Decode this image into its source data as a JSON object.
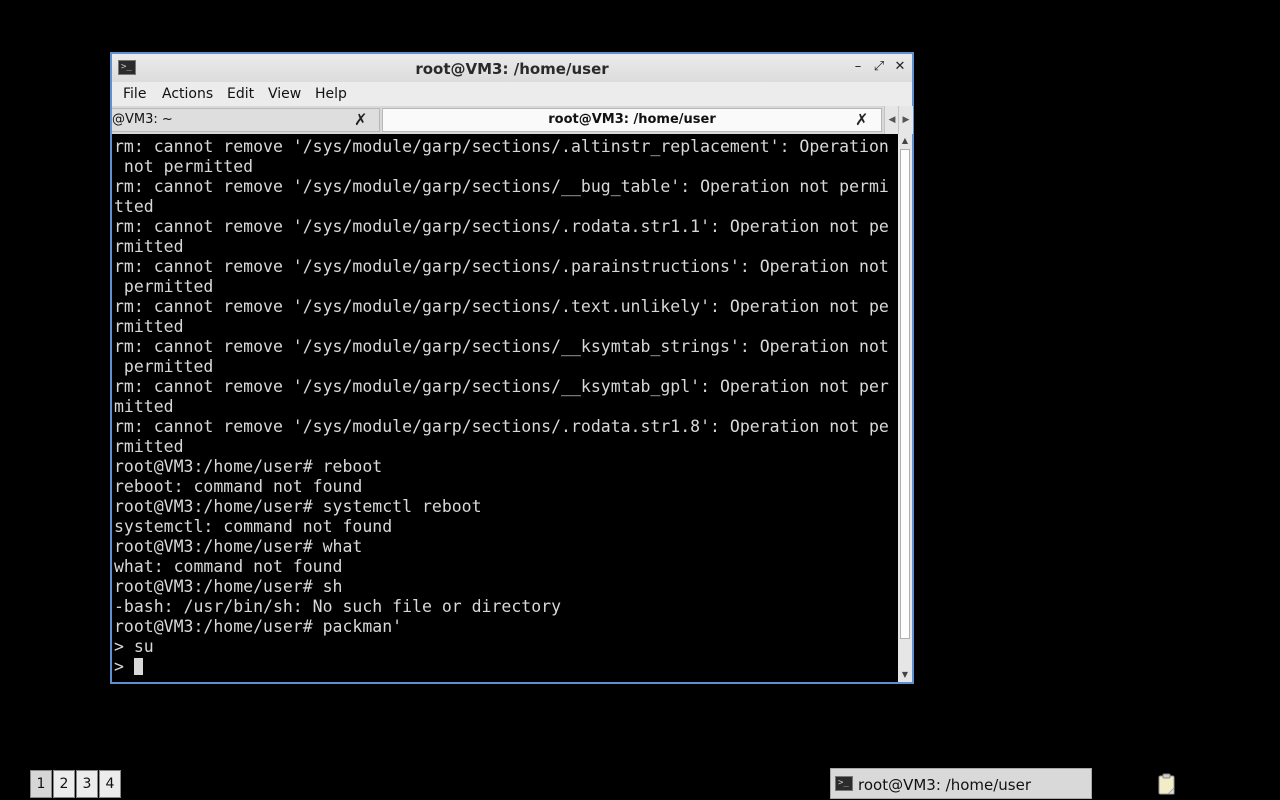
{
  "window": {
    "title": "root@VM3: /home/user",
    "app_icon": "terminal-icon",
    "controls": {
      "minimize": "–",
      "maximize": "⤢",
      "close": "✕"
    }
  },
  "menubar": {
    "items": [
      {
        "label": "File"
      },
      {
        "label": "Actions"
      },
      {
        "label": "Edit"
      },
      {
        "label": "View"
      },
      {
        "label": "Help"
      }
    ]
  },
  "tabs": [
    {
      "label": "@VM3: ~",
      "active": false,
      "close": "✗"
    },
    {
      "label": "root@VM3: /home/user",
      "active": true,
      "close": "✗"
    }
  ],
  "tab_scroll": {
    "left": "◀",
    "right": "▶"
  },
  "terminal": {
    "lines": [
      "rm: cannot remove '/sys/module/garp/sections/.altinstr_replacement': Operation",
      " not permitted",
      "rm: cannot remove '/sys/module/garp/sections/__bug_table': Operation not permi",
      "tted",
      "rm: cannot remove '/sys/module/garp/sections/.rodata.str1.1': Operation not pe",
      "rmitted",
      "rm: cannot remove '/sys/module/garp/sections/.parainstructions': Operation not",
      " permitted",
      "rm: cannot remove '/sys/module/garp/sections/.text.unlikely': Operation not pe",
      "rmitted",
      "rm: cannot remove '/sys/module/garp/sections/__ksymtab_strings': Operation not",
      " permitted",
      "rm: cannot remove '/sys/module/garp/sections/__ksymtab_gpl': Operation not per",
      "mitted",
      "rm: cannot remove '/sys/module/garp/sections/.rodata.str1.8': Operation not pe",
      "rmitted",
      "root@VM3:/home/user# reboot",
      "reboot: command not found",
      "root@VM3:/home/user# systemctl reboot",
      "systemctl: command not found",
      "root@VM3:/home/user# what",
      "what: command not found",
      "root@VM3:/home/user# sh",
      "-bash: /usr/bin/sh: No such file or directory",
      "root@VM3:/home/user# packman'",
      "> su"
    ],
    "prompt_line": "> "
  },
  "taskbar": {
    "workspaces": [
      "1",
      "2",
      "3",
      "4"
    ],
    "task_label": "root@VM3: /home/user",
    "tray_icon": "clipboard-icon"
  }
}
